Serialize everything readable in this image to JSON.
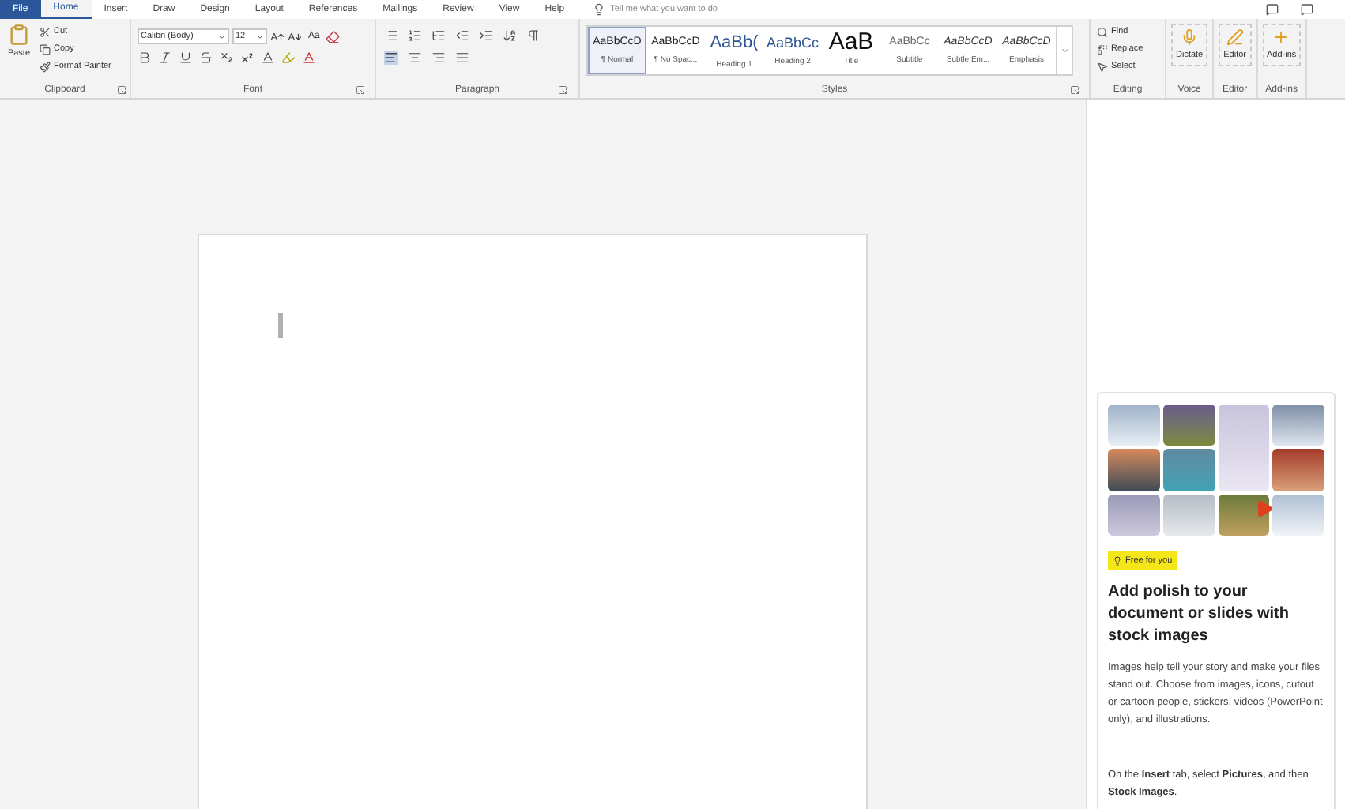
{
  "tabs": [
    {
      "label": "File",
      "kind": "file",
      "selected": false
    },
    {
      "label": "Home",
      "kind": "tab",
      "selected": true
    },
    {
      "label": "Insert",
      "kind": "tab",
      "selected": false
    },
    {
      "label": "Draw",
      "kind": "tab",
      "selected": false
    },
    {
      "label": "Design",
      "kind": "tab",
      "selected": false
    },
    {
      "label": "Layout",
      "kind": "tab",
      "selected": false
    },
    {
      "label": "References",
      "kind": "tab",
      "selected": false
    },
    {
      "label": "Mailings",
      "kind": "tab",
      "selected": false
    },
    {
      "label": "Review",
      "kind": "tab",
      "selected": false
    },
    {
      "label": "View",
      "kind": "tab",
      "selected": false
    },
    {
      "label": "Help",
      "kind": "tab",
      "selected": false
    }
  ],
  "tell_me": {
    "placeholder": "Tell me what you want to do"
  },
  "clipboard": {
    "label": "Clipboard",
    "paste": "Paste",
    "items": [
      "Cut",
      "Copy",
      "Format Painter"
    ]
  },
  "font": {
    "label": "Font",
    "font_name": "Calibri (Body)",
    "font_size": "12",
    "case_button": "Aa"
  },
  "paragraph": {
    "label": "Paragraph"
  },
  "styles": {
    "label": "Styles",
    "items": [
      {
        "preview": "AaBbCcD",
        "name": "¶ Normal",
        "kind": "body",
        "selected": true
      },
      {
        "preview": "AaBbCcD",
        "name": "¶ No Spac...",
        "kind": "body",
        "selected": false
      },
      {
        "preview": "AaBb(",
        "name": "Heading 1",
        "kind": "heading1",
        "selected": false
      },
      {
        "preview": "AaBbCc",
        "name": "Heading 2",
        "kind": "heading2",
        "selected": false
      },
      {
        "preview": "AaB",
        "name": "Title",
        "kind": "title",
        "selected": false
      },
      {
        "preview": "AaBbCc",
        "name": "Subtitle",
        "kind": "subtitle",
        "selected": false
      },
      {
        "preview": "AaBbCcD",
        "name": "Subtle Em...",
        "kind": "italic",
        "selected": false
      },
      {
        "preview": "AaBbCcD",
        "name": "Emphasis",
        "kind": "italic",
        "selected": false
      }
    ]
  },
  "editing": {
    "label": "Editing",
    "items": [
      {
        "label": "Find",
        "kind": "find"
      },
      {
        "label": "Replace",
        "kind": "replace"
      },
      {
        "label": "Select",
        "kind": "select"
      }
    ]
  },
  "big_groups": [
    {
      "button": "Dictate",
      "label": "Voice",
      "kind": "dictate"
    },
    {
      "button": "Editor",
      "label": "Editor",
      "kind": "editor"
    },
    {
      "button": "Add-ins",
      "label": "Add-ins",
      "kind": "addins"
    }
  ],
  "card": {
    "badge": "Free for you",
    "heading": "Add polish to your document or slides with stock images",
    "body": "Images help tell your story and make your files stand out. Choose from images, icons, cutout or cartoon people, stickers, videos (PowerPoint only), and illustrations.",
    "footer": "On the **Insert** tab, select **Pictures**, and then **Stock Images**."
  }
}
